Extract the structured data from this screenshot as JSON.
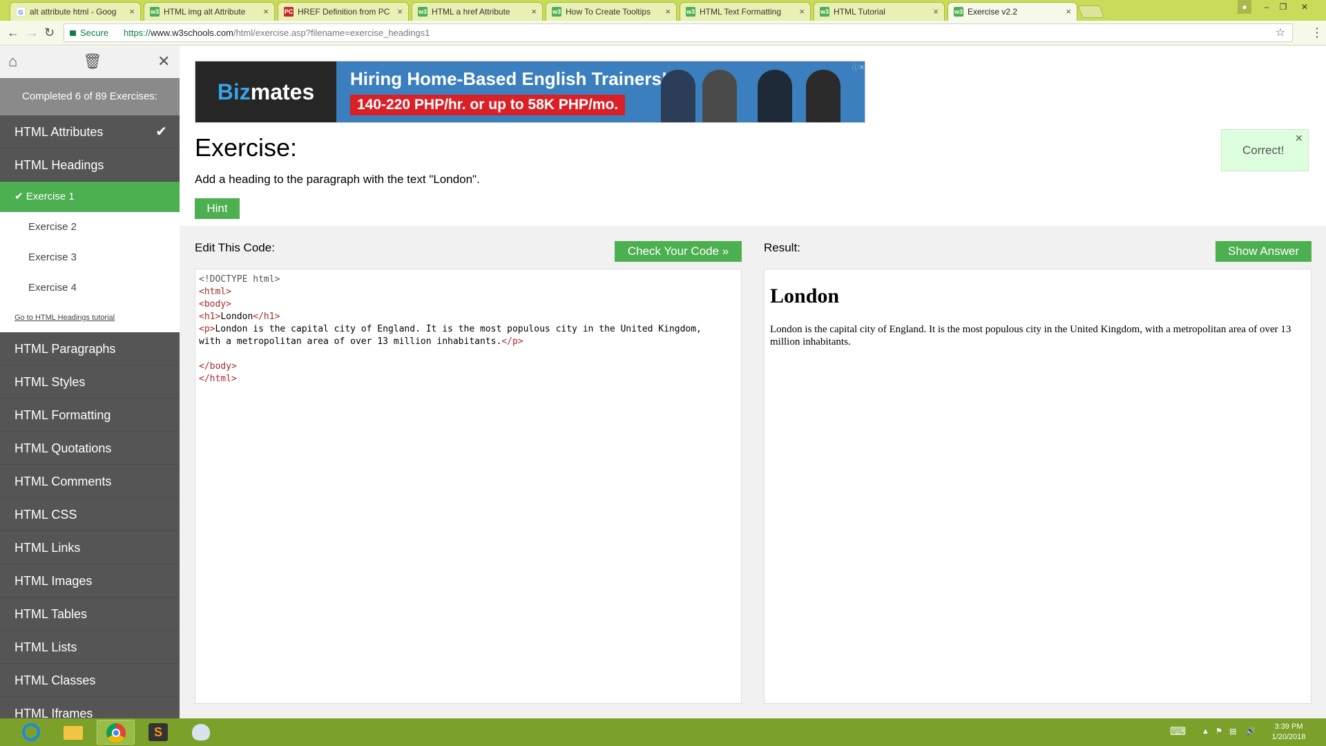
{
  "browser": {
    "tabs": [
      {
        "title": "alt attribute html - Goog",
        "icon": "google-icon",
        "active": false
      },
      {
        "title": "HTML img alt Attribute",
        "icon": "w3schools-icon",
        "active": false
      },
      {
        "title": "HREF Definition from PC",
        "icon": "pc-icon",
        "active": false
      },
      {
        "title": "HTML a href Attribute",
        "icon": "w3schools-icon",
        "active": false
      },
      {
        "title": "How To Create Tooltips",
        "icon": "w3schools-icon",
        "active": false
      },
      {
        "title": "HTML Text Formatting",
        "icon": "w3schools-icon",
        "active": false
      },
      {
        "title": "HTML Tutorial",
        "icon": "w3schools-icon",
        "active": false
      },
      {
        "title": "Exercise v2.2",
        "icon": "w3schools-icon",
        "active": true
      }
    ],
    "tab_close": "×",
    "secure_label": "Secure",
    "url_scheme": "https://",
    "url_host": "www.w3schools.com",
    "url_path": "/html/exercise.asp?filename=exercise_headings1"
  },
  "sidebar": {
    "progress": "Completed 6 of 89 Exercises:",
    "sections_before": [
      {
        "label": "HTML Attributes",
        "completed": true
      }
    ],
    "open_section": {
      "label": "HTML Headings",
      "exercises": [
        "Exercise 1",
        "Exercise 2",
        "Exercise 3",
        "Exercise 4"
      ],
      "active_index": 0,
      "tutorial_link": "Go to HTML Headings tutorial"
    },
    "sections_after": [
      "HTML Paragraphs",
      "HTML Styles",
      "HTML Formatting",
      "HTML Quotations",
      "HTML Comments",
      "HTML CSS",
      "HTML Links",
      "HTML Images",
      "HTML Tables",
      "HTML Lists",
      "HTML Classes",
      "HTML Iframes"
    ]
  },
  "ad": {
    "brand_a": "Biz",
    "brand_b": "mates",
    "headline": "Hiring Home-Based English Trainers!",
    "sub": "140-220 PHP/hr. or up to 58K PHP/mo."
  },
  "exercise": {
    "title": "Exercise:",
    "description": "Add a heading to the paragraph with the text \"London\".",
    "hint_label": "Hint",
    "correct_msg": "Correct!",
    "close_glyph": "×",
    "edit_label": "Edit This Code:",
    "check_label": "Check Your Code »",
    "result_label": "Result:",
    "answer_label": "Show Answer",
    "code": {
      "line1": "<!DOCTYPE html>",
      "line2": "<html>",
      "line3": "<body>",
      "h1_open": "<h1>",
      "h1_text": "London",
      "h1_close": "</h1>",
      "p_open": "<p>",
      "p_text": "London is the capital city of England. It is the most populous city in the United Kingdom,\nwith a metropolitan area of over 13 million inhabitants.",
      "p_close": "</p>",
      "body_close": "</body>",
      "html_close": "</html>"
    },
    "result_heading": "London",
    "result_paragraph": "London is the capital city of England. It is the most populous city in the United Kingdom, with a metropolitan area of over 13 million inhabitants."
  },
  "taskbar": {
    "apps": [
      "internet-explorer-icon",
      "file-explorer-icon",
      "chrome-icon",
      "sublime-text-icon",
      "paint-icon"
    ],
    "time": "3:39 PM",
    "date": "1/20/2018"
  },
  "colors": {
    "accent_green": "#4caf50",
    "sidebar_bg": "#555555",
    "chrome_frame": "#c8dc5a",
    "taskbar": "#7ba12b"
  }
}
